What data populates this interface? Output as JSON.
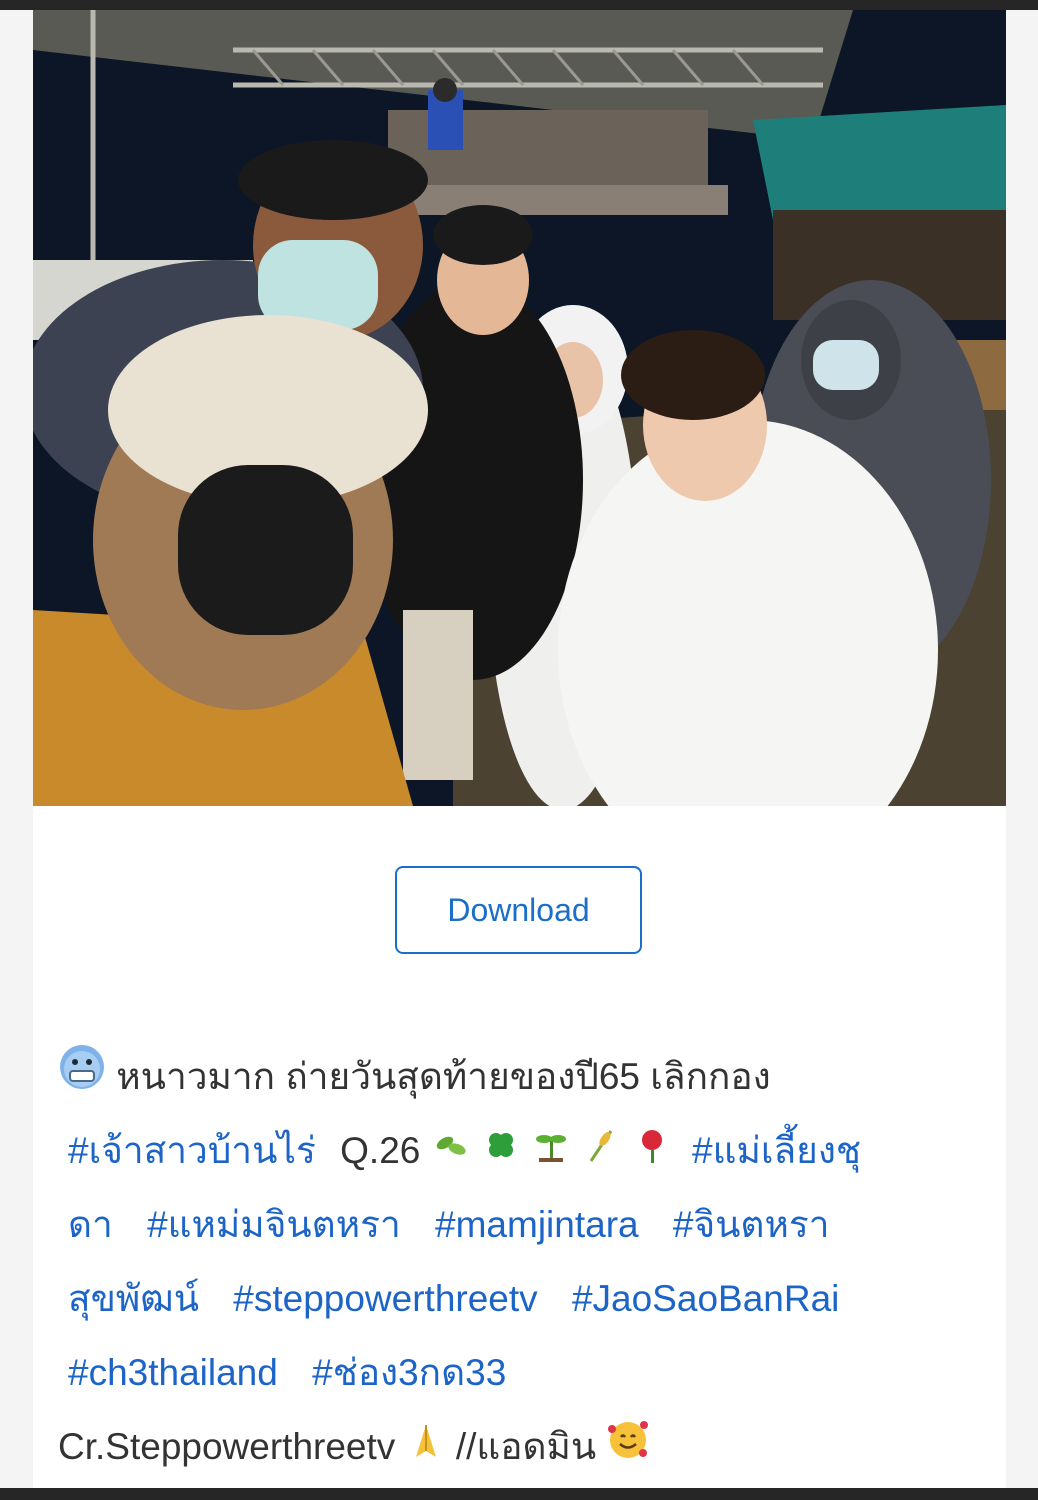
{
  "post": {
    "download_label": "Download",
    "caption": {
      "intro": "หนาวมาก ถ่ายวันสุดท้ายของปี65 เลิกกอง",
      "episode": "Q.26",
      "hashtags": [
        "#เจ้าสาวบ้านไร่",
        "#แม่เลี้ยงชุ",
        "ดา",
        "#แหม่มจินตหรา",
        "#mamjintara",
        "#จินตหรา",
        "สุขพัฒน์",
        "#steppowerthreetv",
        "#JaoSaoBanRai",
        "#ch3thailand",
        "#ช่อง3กด33"
      ],
      "credit": "Cr.Steppowerthreetv",
      "signoff": "//แอดมิน"
    },
    "emojis": [
      "cold-face-emoji",
      "leaves-emoji",
      "clover-emoji",
      "seedling-emoji",
      "rice-emoji",
      "rose-emoji",
      "folded-hands-emoji",
      "smiling-hearts-emoji"
    ]
  },
  "colors": {
    "link": "#1d64c7",
    "button_border": "#1a6fc9",
    "text": "#333333"
  }
}
